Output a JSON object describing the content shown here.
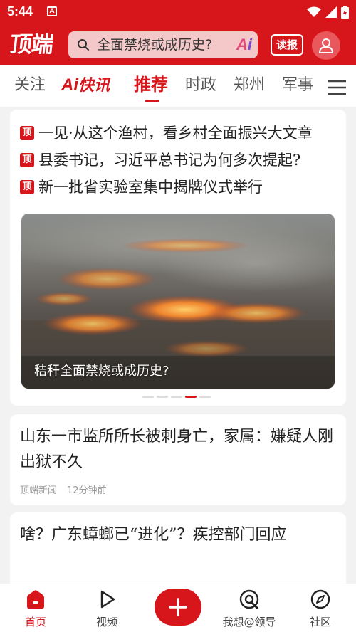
{
  "status_bar": {
    "time": "5:44",
    "app_icon": "A"
  },
  "header": {
    "logo": "顶端",
    "search": {
      "placeholder": "全面禁烧或成历史?",
      "ai_label_a": "A",
      "ai_label_i": "i"
    },
    "dubao_label": "读报"
  },
  "tabs": {
    "items": [
      "关注",
      "快讯",
      "推荐",
      "时政",
      "郑州",
      "军事"
    ],
    "ai_prefix": "Ai",
    "active": "推荐"
  },
  "top_card": {
    "badge": "顶",
    "headlines": [
      "一见·从这个渔村，看乡村全面振兴大文章",
      "县委书记，习近平总书记为何多次提起?",
      "新一批省实验室集中揭牌仪式举行"
    ],
    "hero_caption": "秸秆全面禁烧或成历史?",
    "carousel_active_index": 3,
    "carousel_count": 5
  },
  "news": [
    {
      "title": "山东一市监所所长被刺身亡，家属：嫌疑人刚出狱不久",
      "source": "顶端新闻",
      "time": "12分钟前"
    },
    {
      "title": "啥？广东蟑螂已“进化”？疾控部门回应",
      "source": "",
      "time": ""
    }
  ],
  "bottom_nav": {
    "home": "首页",
    "video": "视频",
    "post": "+",
    "leader": "我想@领导",
    "community": "社区"
  },
  "colors": {
    "brand_red": "#d7161c",
    "ai_purple": "#7b4bd4"
  }
}
